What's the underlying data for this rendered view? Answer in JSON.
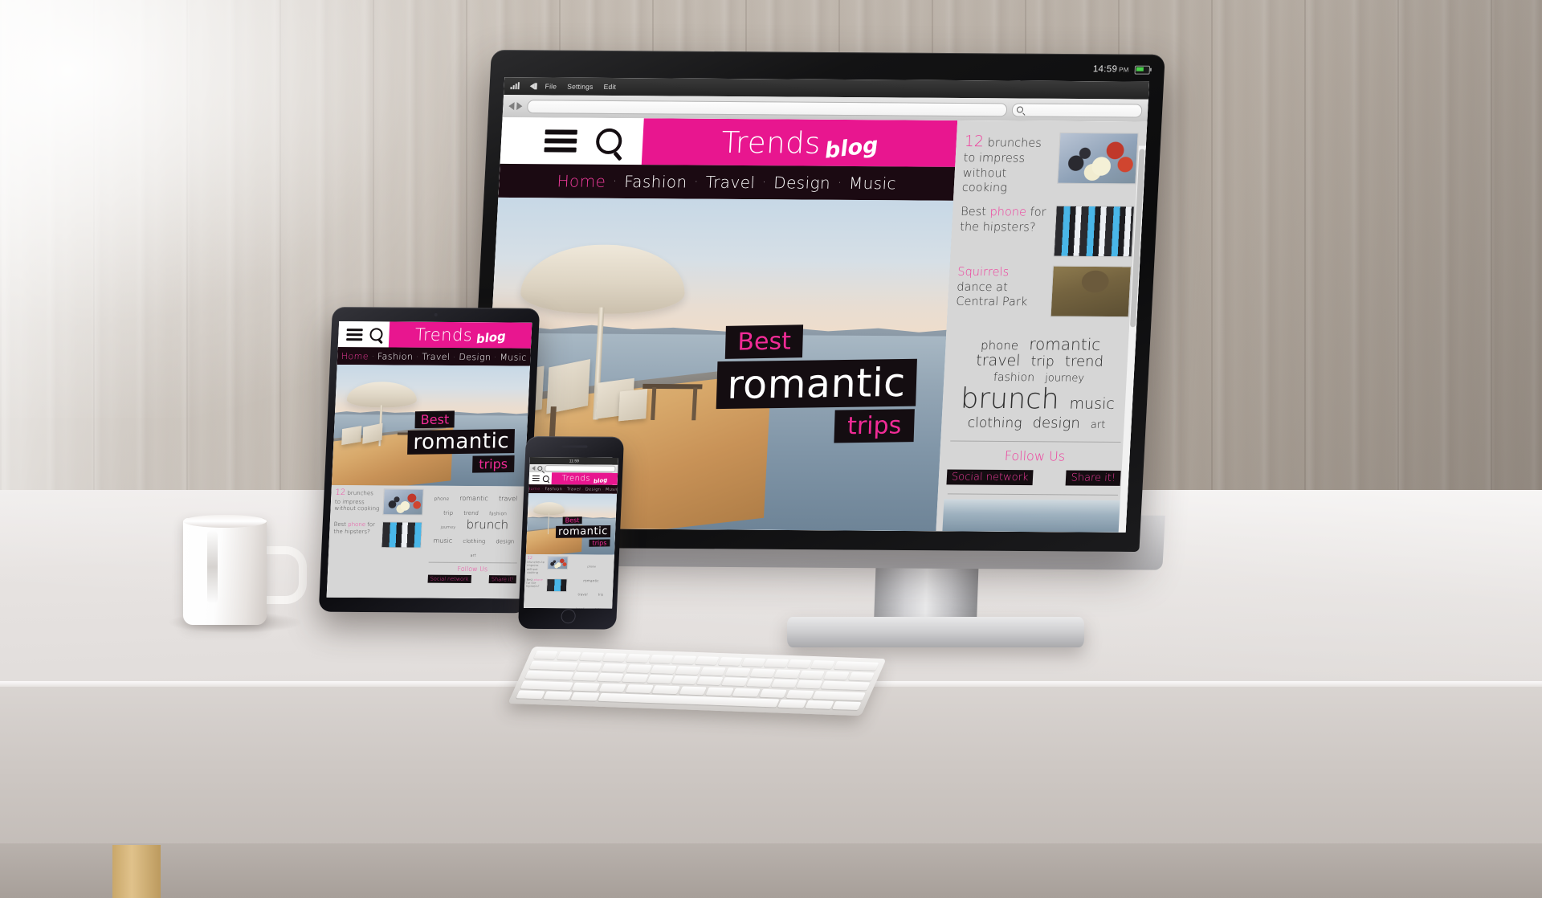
{
  "scene": {
    "description": "Responsive web design mockup on wooden desk",
    "devices": [
      "desktop-monitor",
      "tablet",
      "smartphone"
    ]
  },
  "os_bar": {
    "time": "14:59",
    "meridiem": "PM",
    "signal_icon": "signal-bars-icon",
    "volume_icon": "speaker-icon",
    "battery_icon": "battery-icon"
  },
  "browser": {
    "menu_items": [
      "File",
      "Settings",
      "Edit"
    ],
    "back_icon": "arrow-left-icon",
    "forward_icon": "arrow-right-icon",
    "url_value": "",
    "url_placeholder": "",
    "search_value": "",
    "search_placeholder": "",
    "search_icon": "search-icon"
  },
  "site": {
    "logo": {
      "primary": "Trends",
      "secondary": "blog",
      "menu_icon": "hamburger-menu-icon",
      "search_icon": "search-icon",
      "brand_color": "#e8168f"
    },
    "nav": {
      "separator": "·",
      "items": [
        {
          "label": "Home",
          "active": true
        },
        {
          "label": "Fashion",
          "active": false
        },
        {
          "label": "Travel",
          "active": false
        },
        {
          "label": "Design",
          "active": false
        },
        {
          "label": "Music",
          "active": false
        }
      ],
      "bar_color": "#1b0a12",
      "active_color": "#ef3b9b"
    },
    "hero": {
      "line1": "Best",
      "line2": "romantic",
      "line3": "trips",
      "image_alt": "seaside terrace with umbrella and deck chairs at sunset"
    },
    "sidebar": {
      "articles": [
        {
          "number": "12",
          "text": " brunches to impress without cooking",
          "highlight": "",
          "image": "plate-of-food"
        },
        {
          "prefix": "Best ",
          "highlight": "phone",
          "suffix": " for the hipsters?",
          "image": "smartphones-grid"
        },
        {
          "highlight": "Squirrels",
          "suffix": " dance at Central Park",
          "image": "squirrel-tree"
        }
      ],
      "tag_cloud": [
        {
          "label": "phone",
          "size": 15
        },
        {
          "label": "romantic",
          "size": 20
        },
        {
          "label": "travel",
          "size": 19
        },
        {
          "label": "trip",
          "size": 17
        },
        {
          "label": "trend",
          "size": 18
        },
        {
          "label": "fashion",
          "size": 14
        },
        {
          "label": "journey",
          "size": 13
        },
        {
          "label": "brunch",
          "size": 35
        },
        {
          "label": "music",
          "size": 19
        },
        {
          "label": "clothing",
          "size": 17
        },
        {
          "label": "design",
          "size": 18
        },
        {
          "label": "art",
          "size": 13
        }
      ],
      "follow_label": "Follow Us",
      "social_label": "Social network",
      "share_label": "Share it!"
    }
  },
  "phone": {
    "status_time": "11:59"
  }
}
